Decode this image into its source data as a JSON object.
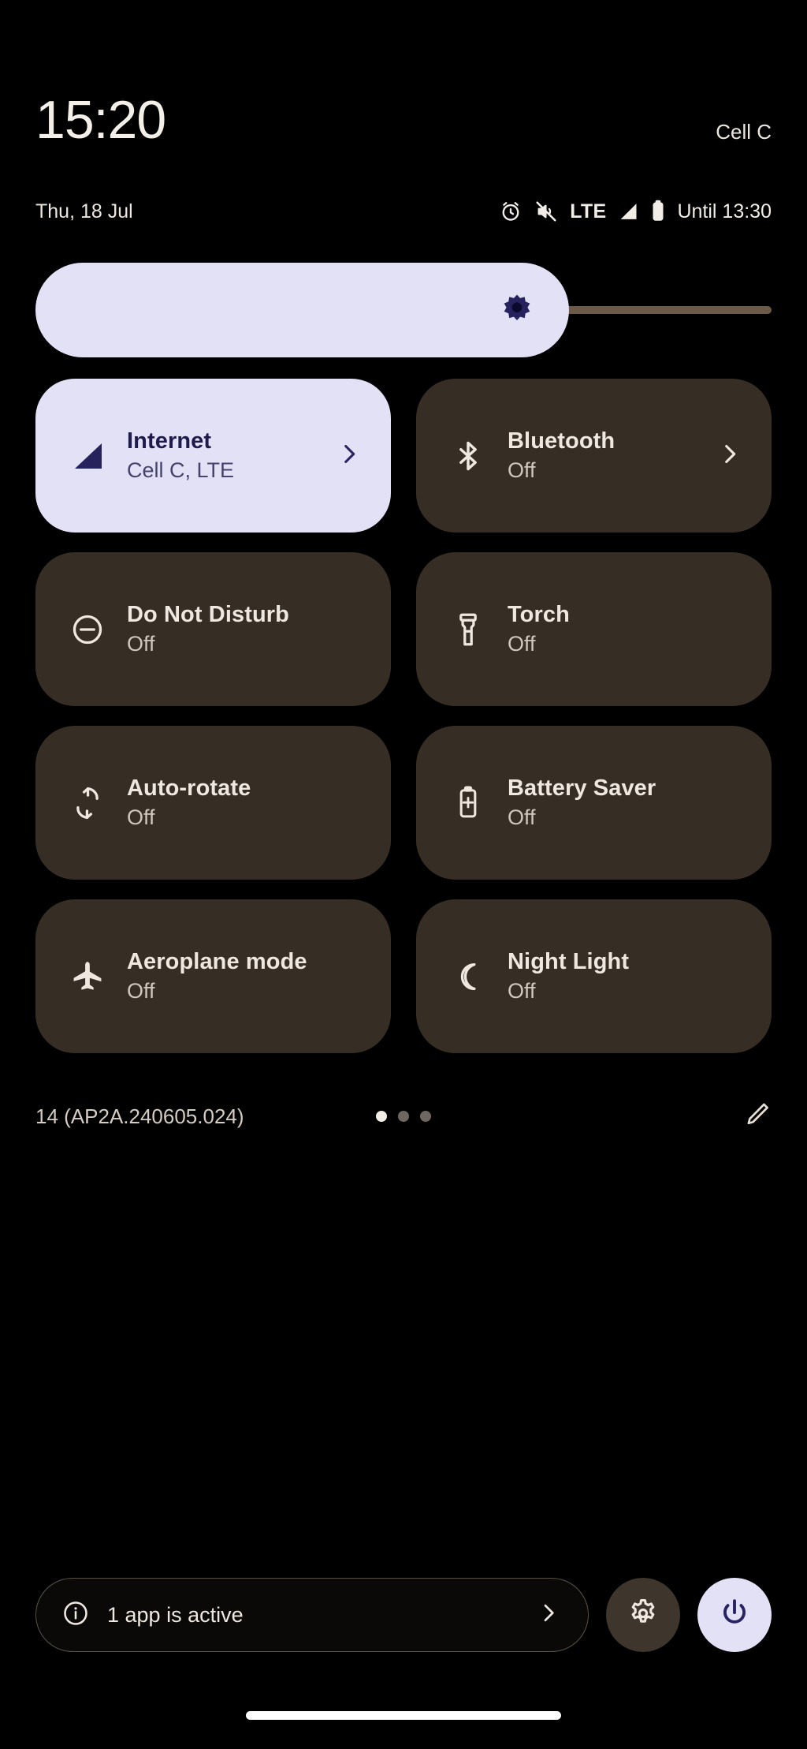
{
  "status": {
    "clock": "15:20",
    "carrier": "Cell C",
    "date": "Thu, 18 Jul",
    "network_type": "LTE",
    "battery_until": "Until 13:30",
    "icons": [
      "alarm-icon",
      "volume-muted-icon",
      "signal-bars-icon",
      "battery-icon"
    ]
  },
  "brightness": {
    "icon": "brightness-icon",
    "level_percent": 72
  },
  "tiles": [
    {
      "name": "internet",
      "title": "Internet",
      "subtitle": "Cell C, LTE",
      "icon": "signal-bars-icon",
      "active": true,
      "expandable": true
    },
    {
      "name": "bluetooth",
      "title": "Bluetooth",
      "subtitle": "Off",
      "icon": "bluetooth-icon",
      "active": false,
      "expandable": true
    },
    {
      "name": "do-not-disturb",
      "title": "Do Not Disturb",
      "subtitle": "Off",
      "icon": "do-not-disturb-icon",
      "active": false,
      "expandable": false
    },
    {
      "name": "torch",
      "title": "Torch",
      "subtitle": "Off",
      "icon": "torch-icon",
      "active": false,
      "expandable": false
    },
    {
      "name": "auto-rotate",
      "title": "Auto-rotate",
      "subtitle": "Off",
      "icon": "auto-rotate-icon",
      "active": false,
      "expandable": false
    },
    {
      "name": "battery-saver",
      "title": "Battery Saver",
      "subtitle": "Off",
      "icon": "battery-saver-icon",
      "active": false,
      "expandable": false
    },
    {
      "name": "aeroplane-mode",
      "title": "Aeroplane mode",
      "subtitle": "Off",
      "icon": "aeroplane-icon",
      "active": false,
      "expandable": false
    },
    {
      "name": "night-light",
      "title": "Night Light",
      "subtitle": "Off",
      "icon": "night-light-icon",
      "active": false,
      "expandable": false
    }
  ],
  "panel_footer": {
    "build": "14 (AP2A.240605.024)",
    "page_count": 3,
    "current_page": 1,
    "edit_icon": "pencil-icon"
  },
  "bottom_bar": {
    "active_apps_label": "1 app is active",
    "info_icon": "info-icon",
    "chevron_icon": "chevron-right-icon",
    "settings_icon": "gear-icon",
    "power_icon": "power-icon"
  },
  "colors": {
    "background": "#000000",
    "tile_inactive": "#362E25",
    "tile_active": "#E3E1F6",
    "accent_navy": "#1F1B4D",
    "text_primary": "#EFE8E1",
    "text_secondary": "#CFC6BD",
    "slider_track": "#6B5A48"
  }
}
